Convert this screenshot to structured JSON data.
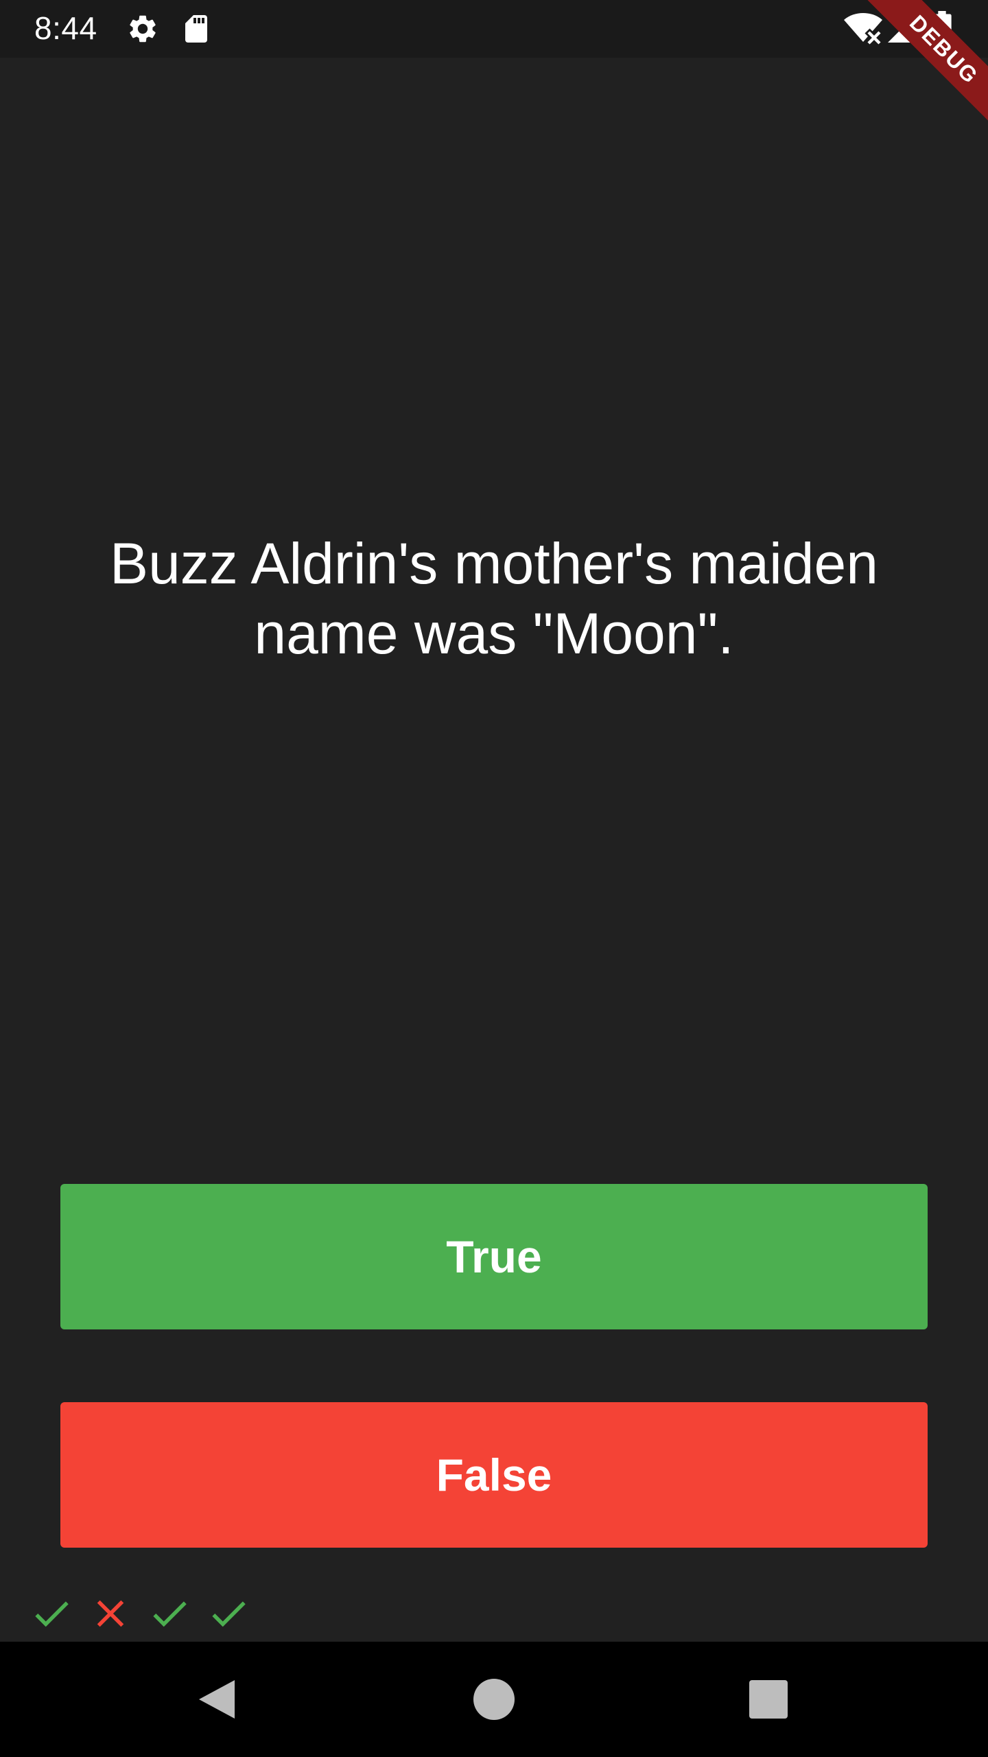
{
  "status_bar": {
    "time": "8:44",
    "icons": [
      "gear-icon",
      "sd-card-icon",
      "wifi-off-icon",
      "signal-icon",
      "battery-icon"
    ]
  },
  "debug_banner": {
    "label": "DEBUG",
    "color": "#8b1a1a"
  },
  "quiz": {
    "question": "Buzz Aldrin's mother's maiden name was \"Moon\".",
    "true_label": "True",
    "false_label": "False",
    "true_color": "#4caf50",
    "false_color": "#f44336",
    "score_keeper": [
      "correct",
      "wrong",
      "correct",
      "correct"
    ],
    "correct_color": "#4caf50",
    "wrong_color": "#f44336"
  },
  "nav_bar": {
    "buttons": [
      "back-icon",
      "home-icon",
      "recents-icon"
    ]
  },
  "theme": {
    "background": "#212121"
  }
}
